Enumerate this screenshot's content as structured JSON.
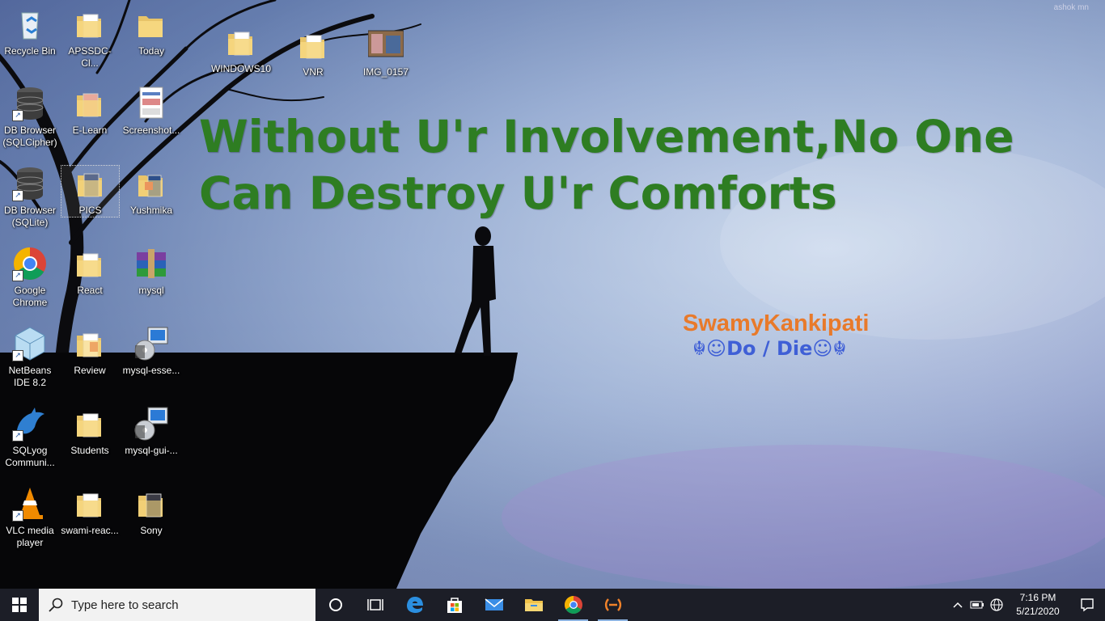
{
  "wallpaper": {
    "quote": "Without U'r Involvement,No One Can Destroy U'r Comforts",
    "signature_name": "SwamyKankipati",
    "signature_motto": "☬☺Do / Die☺☬",
    "watermark": "ashok mn"
  },
  "desktop_icons": [
    {
      "label": "Recycle Bin"
    },
    {
      "label": "APSSDC-Cl..."
    },
    {
      "label": "Today"
    },
    {
      "label": "WINDOWS10"
    },
    {
      "label": "VNR"
    },
    {
      "label": "IMG_0157"
    },
    {
      "label": "DB Browser (SQLCipher)"
    },
    {
      "label": "E-Learn"
    },
    {
      "label": "Screenshot..."
    },
    {
      "label": "DB Browser (SQLite)"
    },
    {
      "label": "PICS"
    },
    {
      "label": "Yushmika"
    },
    {
      "label": "Google Chrome"
    },
    {
      "label": "React"
    },
    {
      "label": "mysql"
    },
    {
      "label": "NetBeans IDE 8.2"
    },
    {
      "label": "Review"
    },
    {
      "label": "mysql-esse..."
    },
    {
      "label": "SQLyog Communi..."
    },
    {
      "label": "Students"
    },
    {
      "label": "mysql-gui-..."
    },
    {
      "label": "VLC media player"
    },
    {
      "label": "swami-reac..."
    },
    {
      "label": "Sony"
    }
  ],
  "taskbar": {
    "search_placeholder": "Type here to search",
    "time": "7:16 PM",
    "date": "5/21/2020"
  }
}
